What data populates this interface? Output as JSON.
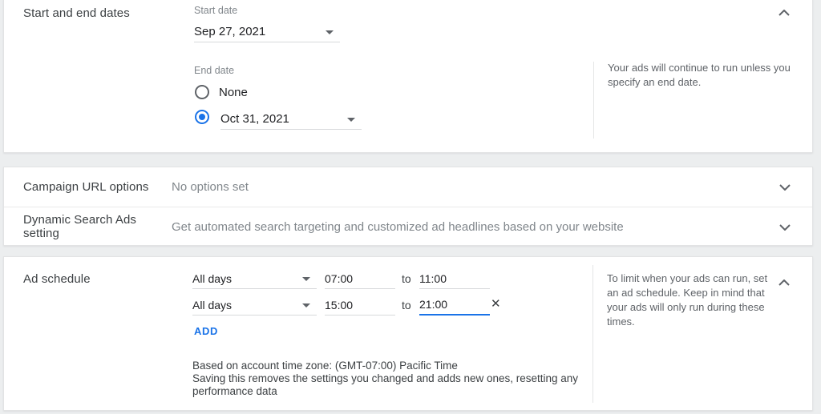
{
  "colors": {
    "accent_blue": "#1a73e8",
    "title_gray": "#3c4043",
    "value_gray": "#80868b",
    "help_gray": "#5f6368"
  },
  "dates_card": {
    "title": "Start and end dates",
    "start_date_label": "Start date",
    "start_date_value": "Sep 27, 2021",
    "end_date_label": "End date",
    "end_options": [
      {
        "label": "None",
        "selected": false
      },
      {
        "label": "Oct 31, 2021",
        "selected": true
      }
    ],
    "help": "Your ads will continue to run unless you specify an end date.",
    "collapse_icon": "chevron-up"
  },
  "campaign_url_row": {
    "title": "Campaign URL options",
    "value": "No options set",
    "expand_icon": "chevron-down"
  },
  "dsa_row": {
    "title": "Dynamic Search Ads setting",
    "value": "Get automated search targeting and customized ad headlines based on your website",
    "expand_icon": "chevron-down"
  },
  "ad_schedule_card": {
    "title": "Ad schedule",
    "rows": [
      {
        "days": "All days",
        "start": "07:00",
        "to": "to",
        "end": "11:00",
        "removable": false,
        "end_focused": false
      },
      {
        "days": "All days",
        "start": "15:00",
        "to": "to",
        "end": "21:00",
        "removable": true,
        "end_focused": true
      }
    ],
    "remove_label": "✕",
    "add_label": "ADD",
    "timezone_note": "Based on account time zone: (GMT-07:00) Pacific Time",
    "reset_warning": "Saving this removes the settings you changed and adds new ones, resetting any performance data",
    "help": "To limit when your ads can run, set an ad schedule. Keep in mind that your ads will only run during these times.",
    "collapse_icon": "chevron-up"
  }
}
